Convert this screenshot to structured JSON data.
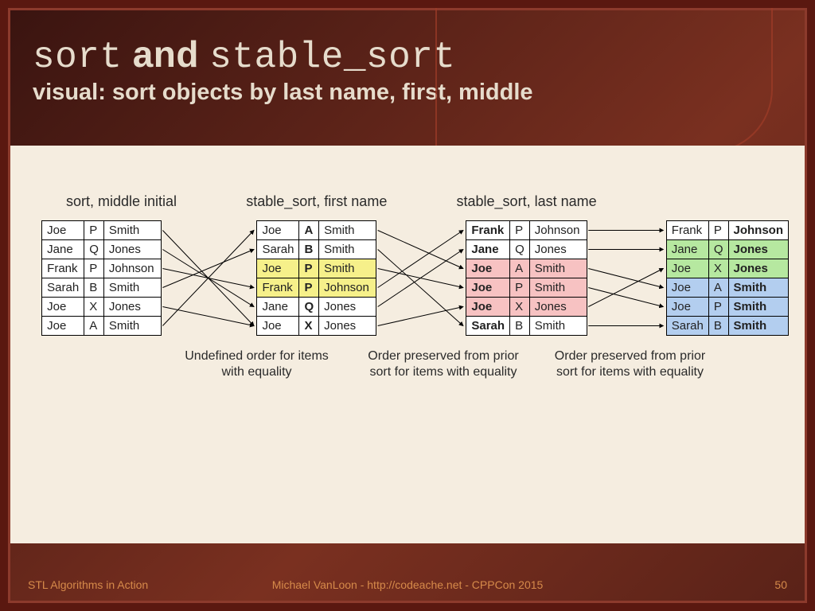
{
  "title": {
    "code1": "sort",
    "and": " and ",
    "code2": "stable_sort"
  },
  "subtitle": "visual: sort objects by last name, first, middle",
  "labels": {
    "col1": "sort, middle initial",
    "col2": "stable_sort, first name",
    "col3": "stable_sort, last name"
  },
  "tables": {
    "t1": [
      {
        "f": "Joe",
        "m": "P",
        "l": "Smith"
      },
      {
        "f": "Jane",
        "m": "Q",
        "l": "Jones"
      },
      {
        "f": "Frank",
        "m": "P",
        "l": "Johnson"
      },
      {
        "f": "Sarah",
        "m": "B",
        "l": "Smith"
      },
      {
        "f": "Joe",
        "m": "X",
        "l": "Jones"
      },
      {
        "f": "Joe",
        "m": "A",
        "l": "Smith"
      }
    ],
    "t2": [
      {
        "f": "Joe",
        "m": "A",
        "l": "Smith",
        "hl": ""
      },
      {
        "f": "Sarah",
        "m": "B",
        "l": "Smith",
        "hl": ""
      },
      {
        "f": "Joe",
        "m": "P",
        "l": "Smith",
        "hl": "hl-yellow"
      },
      {
        "f": "Frank",
        "m": "P",
        "l": "Johnson",
        "hl": "hl-yellow"
      },
      {
        "f": "Jane",
        "m": "Q",
        "l": "Jones",
        "hl": ""
      },
      {
        "f": "Joe",
        "m": "X",
        "l": "Jones",
        "hl": ""
      }
    ],
    "t3": [
      {
        "f": "Frank",
        "m": "P",
        "l": "Johnson",
        "hl": ""
      },
      {
        "f": "Jane",
        "m": "Q",
        "l": "Jones",
        "hl": ""
      },
      {
        "f": "Joe",
        "m": "A",
        "l": "Smith",
        "hl": "hl-pink"
      },
      {
        "f": "Joe",
        "m": "P",
        "l": "Smith",
        "hl": "hl-pink"
      },
      {
        "f": "Joe",
        "m": "X",
        "l": "Jones",
        "hl": "hl-pink"
      },
      {
        "f": "Sarah",
        "m": "B",
        "l": "Smith",
        "hl": ""
      }
    ],
    "t4": [
      {
        "f": "Frank",
        "m": "P",
        "l": "Johnson",
        "hl": ""
      },
      {
        "f": "Jane",
        "m": "Q",
        "l": "Jones",
        "hl": "hl-green"
      },
      {
        "f": "Joe",
        "m": "X",
        "l": "Jones",
        "hl": "hl-green"
      },
      {
        "f": "Joe",
        "m": "A",
        "l": "Smith",
        "hl": "hl-blue"
      },
      {
        "f": "Joe",
        "m": "P",
        "l": "Smith",
        "hl": "hl-blue"
      },
      {
        "f": "Sarah",
        "m": "B",
        "l": "Smith",
        "hl": "hl-blue"
      }
    ]
  },
  "captions": {
    "c1": "Undefined order for items with equality",
    "c2": "Order preserved from prior sort for items with equality",
    "c3": "Order preserved from prior sort for items with equality"
  },
  "arrows": {
    "set1": [
      [
        0,
        5
      ],
      [
        1,
        4
      ],
      [
        2,
        3
      ],
      [
        3,
        1
      ],
      [
        4,
        5
      ],
      [
        5,
        0
      ]
    ],
    "set2": [
      [
        0,
        2
      ],
      [
        1,
        5
      ],
      [
        2,
        3
      ],
      [
        3,
        0
      ],
      [
        4,
        1
      ],
      [
        5,
        4
      ]
    ],
    "set3": [
      [
        0,
        0
      ],
      [
        1,
        1
      ],
      [
        2,
        3
      ],
      [
        3,
        4
      ],
      [
        4,
        2
      ],
      [
        5,
        5
      ]
    ]
  },
  "footer": {
    "left": "STL Algorithms in Action",
    "center": "Michael VanLoon - http://codeache.net - CPPCon 2015",
    "right": "50"
  }
}
